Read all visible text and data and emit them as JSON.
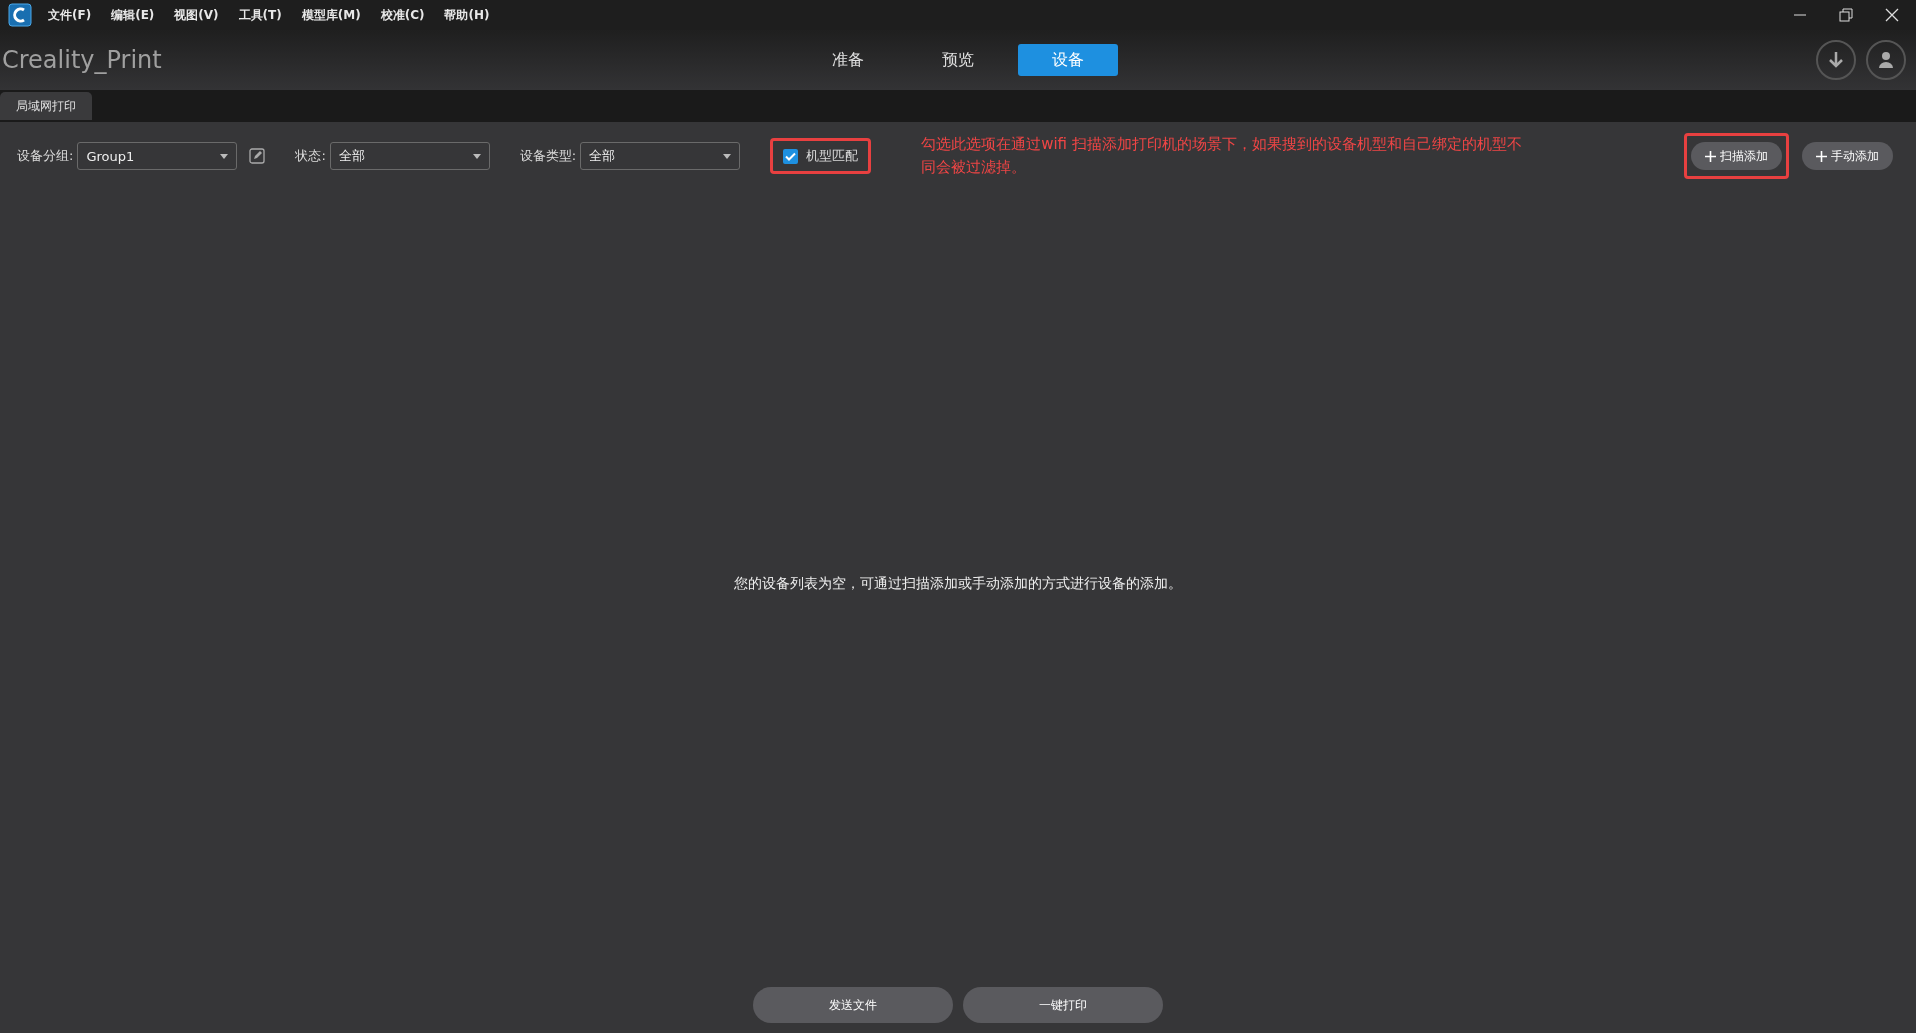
{
  "menu_bar": {
    "items": [
      "文件(F)",
      "编辑(E)",
      "视图(V)",
      "工具(T)",
      "模型库(M)",
      "校准(C)",
      "帮助(H)"
    ]
  },
  "header": {
    "app_title": "Creality_Print",
    "mode_tabs": [
      {
        "label": "准备",
        "selected": false
      },
      {
        "label": "预览",
        "selected": false
      },
      {
        "label": "设备",
        "selected": true
      }
    ]
  },
  "sub_tabs": [
    {
      "label": "局域网打印",
      "selected": true
    }
  ],
  "filters": [
    {
      "label": "设备分组:",
      "value": "Group1",
      "editable": true
    },
    {
      "label": "状态:",
      "value": "全部",
      "editable": false
    },
    {
      "label": "设备类型:",
      "value": "全部",
      "editable": false
    }
  ],
  "model_match": {
    "label": "机型匹配",
    "checked": true,
    "highlighted": true
  },
  "annotation": "勾选此选项在通过wifi 扫描添加打印机的场景下，如果搜到的设备机型和自己绑定的机型不同会被过滤掉。",
  "add_buttons": [
    {
      "label": "扫描添加",
      "highlighted": true
    },
    {
      "label": "手动添加",
      "highlighted": false
    }
  ],
  "empty_message": "您的设备列表为空，可通过扫描添加或手动添加的方式进行设备的添加。",
  "bottom_buttons": [
    "发送文件",
    "一键打印"
  ]
}
